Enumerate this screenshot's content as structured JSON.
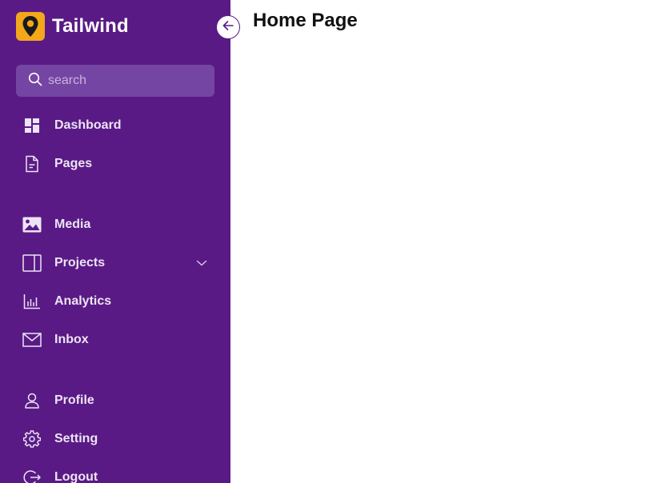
{
  "app": {
    "brand_title": "Tailwind"
  },
  "search": {
    "placeholder": "search"
  },
  "sidebar": {
    "items": [
      {
        "label": "Dashboard",
        "icon": "dashboard-icon"
      },
      {
        "label": "Pages",
        "icon": "document-icon"
      },
      {
        "label": "Media",
        "icon": "image-icon"
      },
      {
        "label": "Projects",
        "icon": "panel-icon",
        "expandable": true
      },
      {
        "label": "Analytics",
        "icon": "bar-chart-icon"
      },
      {
        "label": "Inbox",
        "icon": "mail-icon"
      },
      {
        "label": "Profile",
        "icon": "user-icon"
      },
      {
        "label": "Setting",
        "icon": "gear-icon"
      },
      {
        "label": "Logout",
        "icon": "logout-icon"
      }
    ]
  },
  "main": {
    "title": "Home Page"
  },
  "colors": {
    "sidebar_bg": "#5a1a85",
    "search_bg": "#7545a3",
    "logo_bg": "#f3a71b",
    "nav_text": "#ece4f4"
  }
}
